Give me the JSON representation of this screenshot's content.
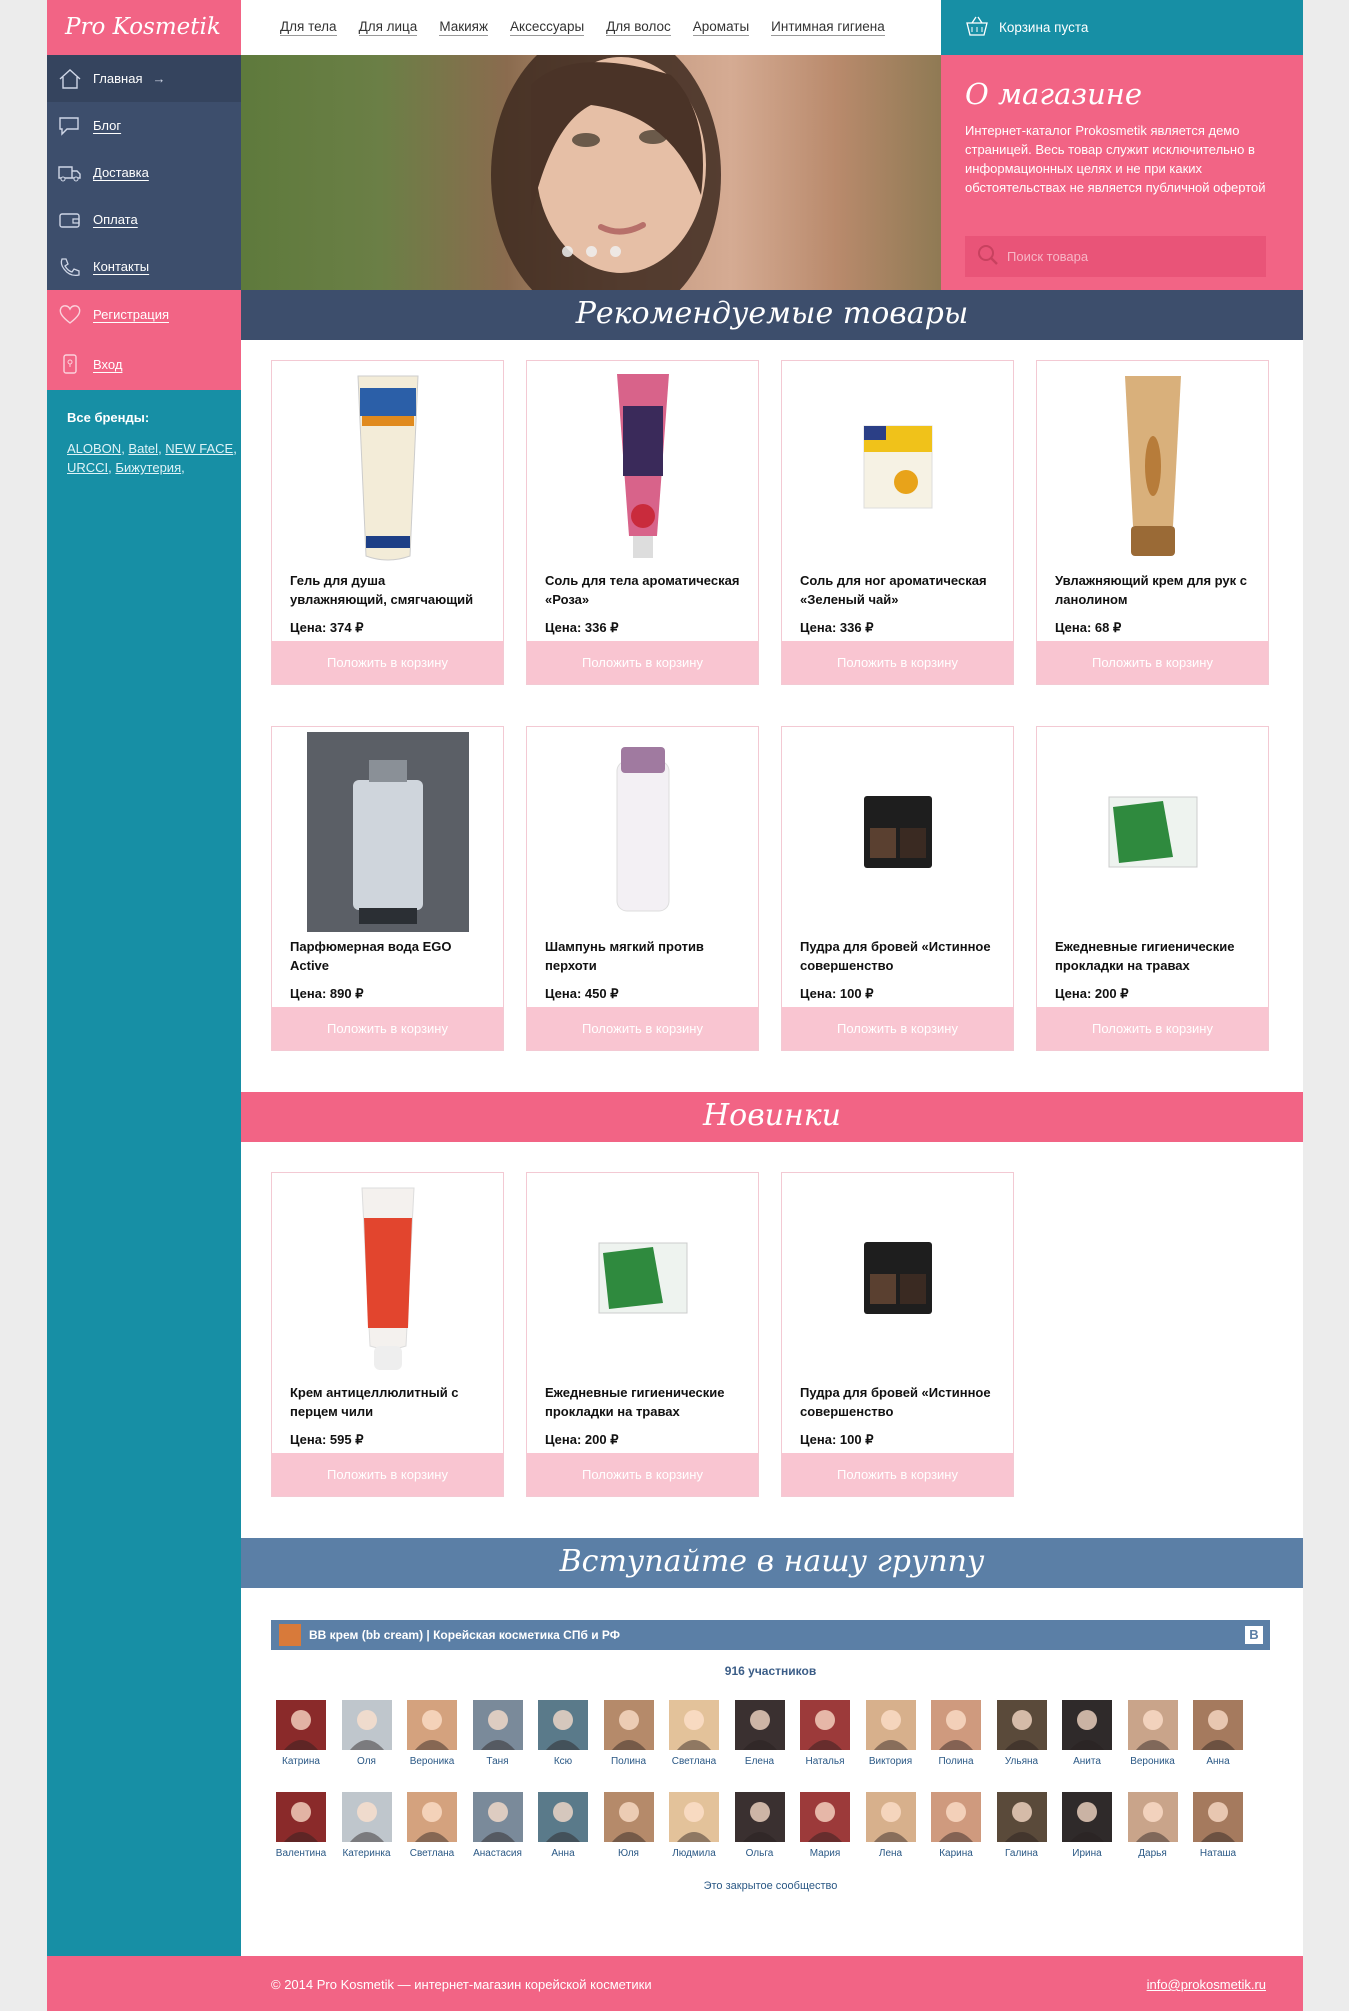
{
  "logo": "Pro Kosmetik",
  "main_nav": [
    {
      "label": "Главная",
      "icon": "home-icon"
    },
    {
      "label": "Блог",
      "icon": "chat-icon"
    },
    {
      "label": "Доставка",
      "icon": "truck-icon"
    },
    {
      "label": "Оплата",
      "icon": "wallet-icon"
    },
    {
      "label": "Контакты",
      "icon": "phone-icon"
    }
  ],
  "user_nav": [
    {
      "label": "Регистрация",
      "icon": "heart-icon"
    },
    {
      "label": "Вход",
      "icon": "lock-icon"
    }
  ],
  "brands": {
    "title": "Все бренды:",
    "items": [
      "ALOBON",
      "Batel",
      "NEW FACE",
      "URCCI",
      "Бижутерия"
    ]
  },
  "top_nav": [
    "Для тела",
    "Для лица",
    "Макияж",
    "Аксессуары",
    "Для волос",
    "Ароматы",
    "Интимная гигиена"
  ],
  "cart": {
    "label": "Корзина пуста"
  },
  "about": {
    "title": "О магазине",
    "text": "Интернет-каталог Prokosmetik является демо страницей. Весь товар служит исключительно в информационных целях и не при каких обстоятельствах не является публичной офертой",
    "search_placeholder": "Поиск товара"
  },
  "colors": {
    "pink": "#f26485",
    "teal": "#178fa5",
    "navy": "#3d4e6c",
    "steel": "#5b7fa6",
    "button_pink": "#f9c5d1"
  },
  "buy_label": "Положить в корзину",
  "featured": {
    "title": "Рекомендуемые товары",
    "products": [
      {
        "name": "Гель для душа увлажняющий, смягчающий",
        "price": "Цена: 374 ₽"
      },
      {
        "name": "Соль для тела ароматическая «Роза»",
        "price": "Цена: 336 ₽"
      },
      {
        "name": "Соль для ног ароматическая «Зеленый чай»",
        "price": "Цена: 336 ₽"
      },
      {
        "name": "Увлажняющий крем для рук с ланолином",
        "price": "Цена: 68 ₽"
      },
      {
        "name": "Парфюмерная вода EGO Active",
        "price": "Цена: 890 ₽"
      },
      {
        "name": "Шампунь мягкий против перхоти",
        "price": "Цена: 450 ₽"
      },
      {
        "name": "Пудра для бровей «Истинное совершенство",
        "price": "Цена: 100 ₽"
      },
      {
        "name": "Ежедневные гигиенические прокладки на травах",
        "price": "Цена: 200 ₽"
      }
    ]
  },
  "new_items": {
    "title": "Новинки",
    "products": [
      {
        "name": "Крем антицеллюлитный с перцем чили",
        "price": "Цена: 595 ₽"
      },
      {
        "name": "Ежедневные гигиенические прокладки на травах",
        "price": "Цена: 200 ₽"
      },
      {
        "name": "Пудра для бровей «Истинное совершенство",
        "price": "Цена: 100 ₽"
      }
    ]
  },
  "group": {
    "title": "Вступайте в нашу группу",
    "vk_name": "BB крем (bb cream) | Корейская косметика СПб и РФ",
    "vk_logo": "В",
    "members_count": "916 участников",
    "members": [
      "Катрина",
      "Оля",
      "Вероника",
      "Таня",
      "Ксю",
      "Полина",
      "Светлана",
      "Елена",
      "Наталья",
      "Виктория",
      "Полина",
      "Ульяна",
      "Анита",
      "Вероника",
      "Анна",
      "Валентина",
      "Катеринка",
      "Светлана",
      "Анастасия",
      "Анна",
      "Юля",
      "Людмила",
      "Ольга",
      "Мария",
      "Лена",
      "Карина",
      "Галина",
      "Ирина",
      "Дарья",
      "Наташа"
    ],
    "closed_note": "Это закрытое сообщество"
  },
  "footer": {
    "copyright": "© 2014 Pro Kosmetik — интернет-магазин корейской косметики",
    "email": "info@prokosmetik.ru"
  }
}
